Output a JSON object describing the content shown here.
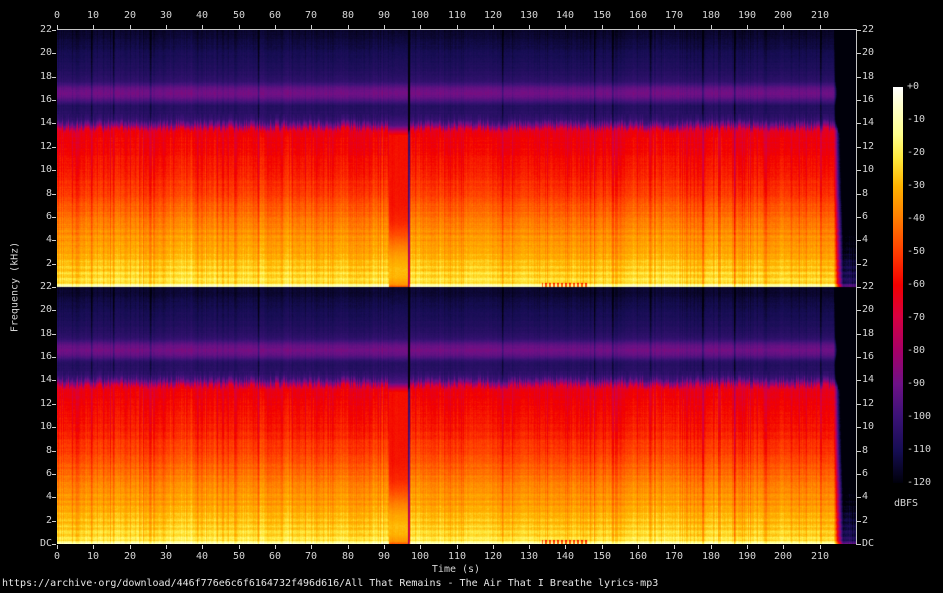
{
  "caption": {
    "url": "https://archive·org/download/446f776e6c6f6164732f496d616/All That Remains - The Air That I Breathe lyrics·mp3"
  },
  "chart_data": {
    "type": "heatmap",
    "subtype": "stereo_audio_spectrogram",
    "channels": 2,
    "channel_order": [
      "left",
      "right"
    ],
    "x": {
      "label": "Time (s)",
      "range": [
        0,
        220
      ],
      "ticks": [
        0,
        10,
        20,
        30,
        40,
        50,
        60,
        70,
        80,
        90,
        100,
        110,
        120,
        130,
        140,
        150,
        160,
        170,
        180,
        190,
        200,
        210
      ]
    },
    "y": {
      "label": "Frequency (kHz)",
      "range": [
        0,
        22
      ],
      "ticks": [
        22,
        20,
        18,
        16,
        14,
        12,
        10,
        8,
        6,
        4,
        2
      ],
      "dc_label": "DC"
    },
    "z": {
      "label": "dBFS",
      "range": [
        -120,
        0
      ],
      "tick_labels": [
        "+0",
        "-10",
        "-20",
        "-30",
        "-40",
        "-50",
        "-60",
        "-70",
        "-80",
        "-90",
        "-100",
        "-110",
        "-120"
      ]
    },
    "palette_stops": [
      {
        "at": 0.0,
        "color": "#ffffff"
      },
      {
        "at": 0.045,
        "color": "#ffffcf"
      },
      {
        "at": 0.12,
        "color": "#ffff8c"
      },
      {
        "at": 0.18,
        "color": "#ffe93c"
      },
      {
        "at": 0.25,
        "color": "#ffb300"
      },
      {
        "at": 0.33,
        "color": "#ff7e00"
      },
      {
        "at": 0.42,
        "color": "#ff3b00"
      },
      {
        "at": 0.5,
        "color": "#f20000"
      },
      {
        "at": 0.58,
        "color": "#d60040"
      },
      {
        "at": 0.67,
        "color": "#a40069"
      },
      {
        "at": 0.75,
        "color": "#6e1186"
      },
      {
        "at": 0.83,
        "color": "#3c1277"
      },
      {
        "at": 0.92,
        "color": "#150d52"
      },
      {
        "at": 1.0,
        "color": "#00000a"
      }
    ],
    "spectral_profile_db_by_khz": [
      [
        0,
        -20
      ],
      [
        0.4,
        -22
      ],
      [
        1,
        -24
      ],
      [
        2,
        -28
      ],
      [
        3,
        -32
      ],
      [
        4,
        -35
      ],
      [
        5,
        -38
      ],
      [
        6,
        -42
      ],
      [
        7,
        -46
      ],
      [
        8,
        -50
      ],
      [
        9,
        -53
      ],
      [
        10,
        -56
      ],
      [
        11,
        -58
      ],
      [
        12,
        -60
      ],
      [
        13,
        -62
      ],
      [
        13.4,
        -64
      ],
      [
        13.8,
        -86
      ],
      [
        14.2,
        -100
      ],
      [
        14.8,
        -105
      ],
      [
        15.5,
        -106
      ],
      [
        16.2,
        -92
      ],
      [
        16.6,
        -89
      ],
      [
        17.0,
        -92
      ],
      [
        17.6,
        -103
      ],
      [
        18.2,
        -106
      ],
      [
        19,
        -108
      ],
      [
        20,
        -110
      ],
      [
        21,
        -113
      ],
      [
        22,
        -116
      ]
    ],
    "quiet_profile_db_by_khz": [
      [
        0,
        -48
      ],
      [
        0.2,
        -36
      ],
      [
        0.8,
        -30
      ],
      [
        1.5,
        -29
      ],
      [
        2.5,
        -33
      ],
      [
        3.5,
        -40
      ],
      [
        4.5,
        -48
      ],
      [
        5.5,
        -54
      ],
      [
        7,
        -57
      ],
      [
        13,
        -58
      ],
      [
        13.3,
        -70
      ],
      [
        13.8,
        -95
      ],
      [
        14.2,
        -100
      ]
    ],
    "features": {
      "lossy_cutoff_khz": 13.6,
      "encoder_noise_band_khz": [
        15.8,
        17.2
      ],
      "quiet_bridge_s": [
        91.3,
        96.9
      ],
      "hard_stop_s": 96.9,
      "content_end_s": 213.9,
      "section_breaks_s": [
        9.4,
        15.4,
        25.6,
        55.3,
        122.5,
        147.8,
        152.9,
        163.3,
        177.6,
        186.5,
        210.1
      ],
      "dc_dropout_dashes_s": [
        133.5,
        146
      ]
    }
  }
}
